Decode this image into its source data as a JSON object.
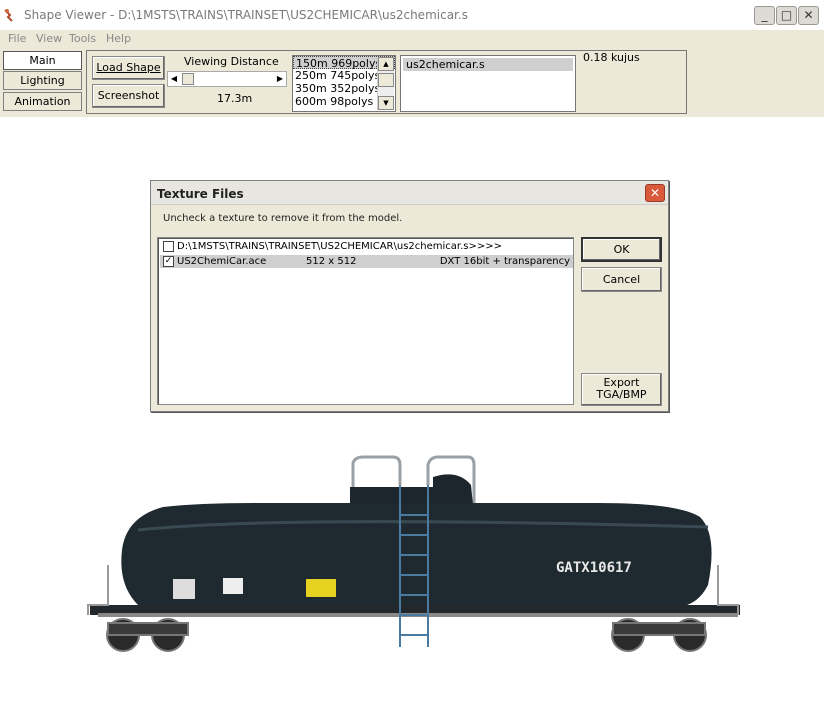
{
  "window": {
    "title": "Shape Viewer - D:\\1MSTS\\TRAINS\\TRAINSET\\US2CHEMICAR\\us2chemicar.s",
    "controls": {
      "minimize": "_",
      "maximize": "□",
      "close": "✕"
    }
  },
  "menu": {
    "items": [
      "File",
      "View",
      "Tools",
      "Help"
    ]
  },
  "nav": {
    "main": "Main",
    "lighting": "Lighting",
    "animation": "Animation"
  },
  "toolbar": {
    "load_shape": "Load Shape",
    "screenshot": "Screenshot",
    "viewing_distance_label": "Viewing Distance",
    "viewing_distance_value": "17.3m",
    "lod_items": [
      "150m 969polys",
      "250m 745polys",
      "350m 352polys",
      "600m 98polys"
    ],
    "shape_items": [
      "us2chemicar.s"
    ],
    "info": "0.18 kujus"
  },
  "dialog": {
    "title": "Texture Files",
    "close": "✕",
    "instruction": "Uncheck a texture to remove it from the model.",
    "rows": [
      {
        "checked": "",
        "name": "D:\\1MSTS\\TRAINS\\TRAINSET\\US2CHEMICAR\\us2chemicar.s>>>>",
        "size": "",
        "format": ""
      },
      {
        "checked": "✓",
        "name": "US2ChemiCar.ace",
        "size": "512 x 512",
        "format": "DXT 16bit + transparency"
      }
    ],
    "ok": "OK",
    "cancel": "Cancel",
    "export_line1": "Export",
    "export_line2": "TGA/BMP"
  },
  "car": {
    "reporting_mark": "GATX10617",
    "body_color": "#1e2a30"
  }
}
